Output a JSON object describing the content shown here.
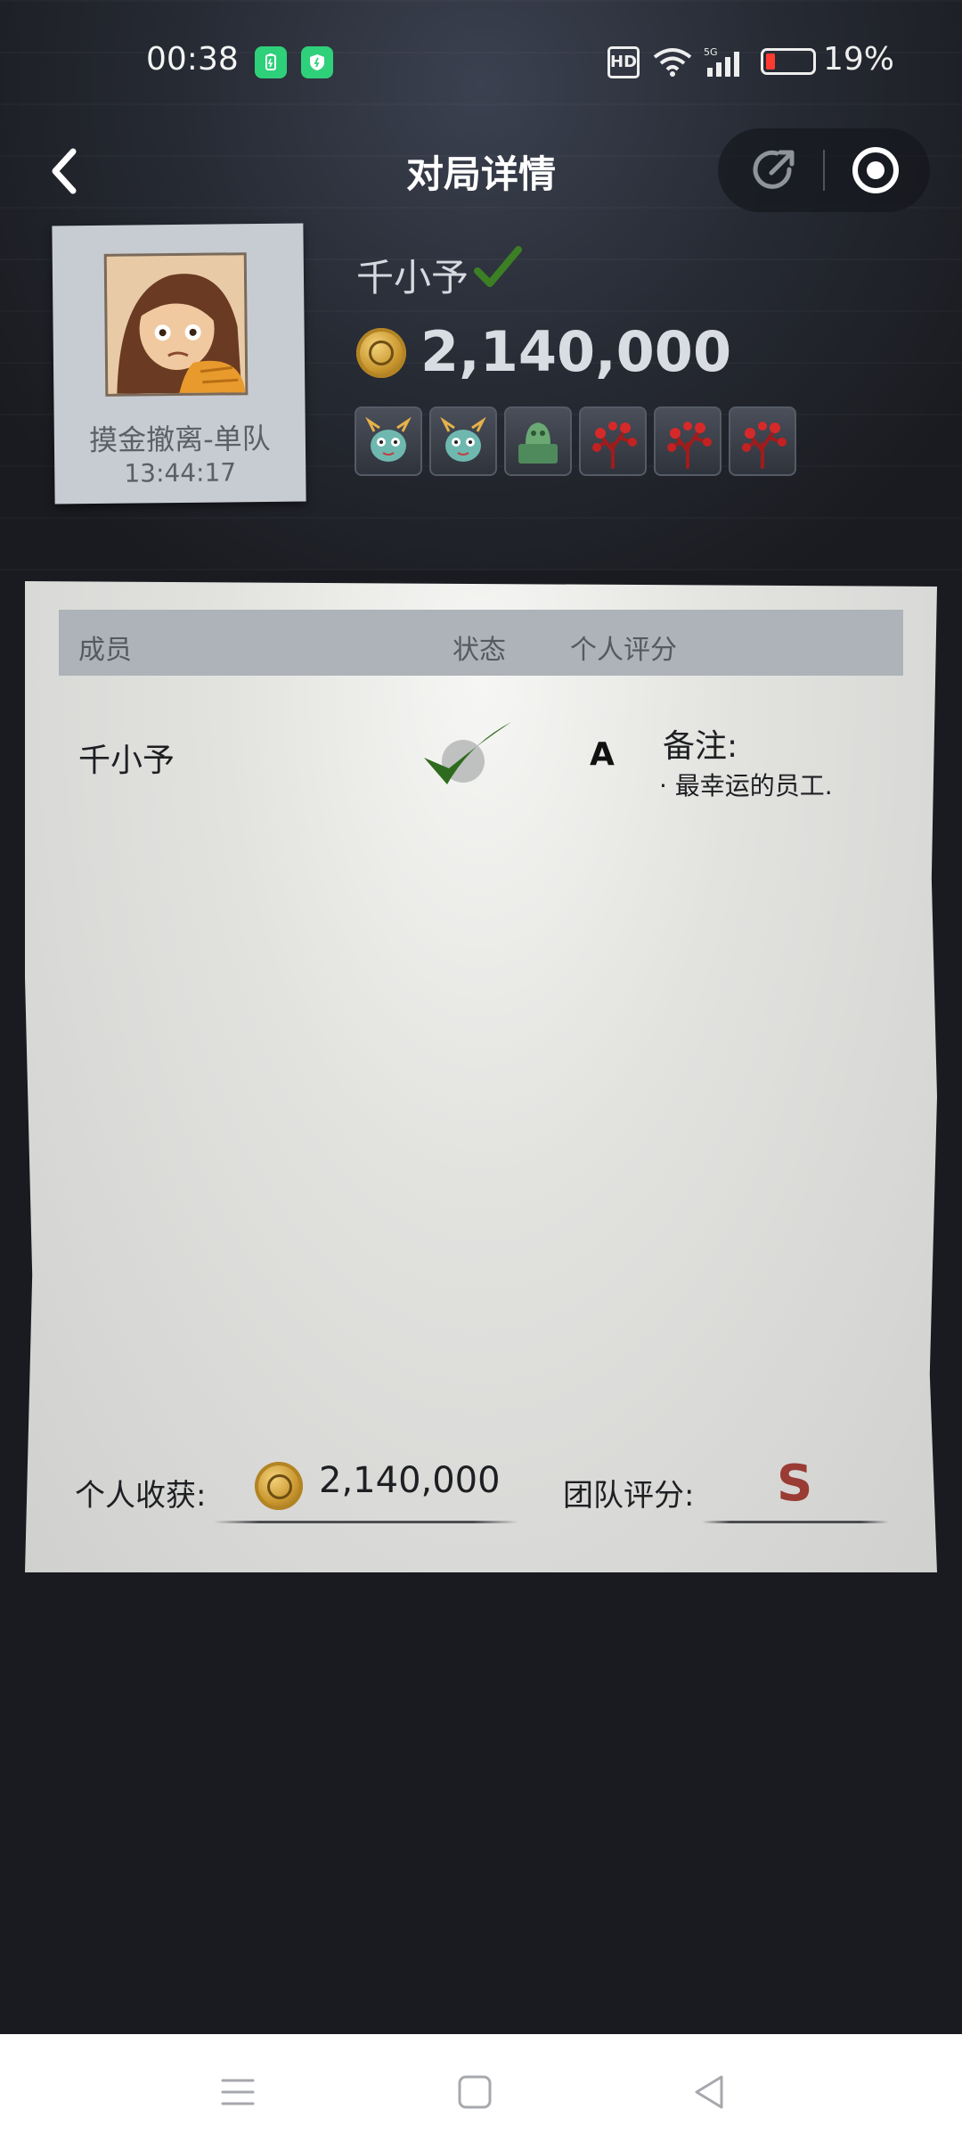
{
  "status_bar": {
    "time": "00:38",
    "network_badge": "HD",
    "network_type": "5G",
    "battery_percent": "19%",
    "battery_level": 0.19,
    "notification_icons": [
      "battery-saver-icon",
      "security-shield-icon"
    ]
  },
  "header": {
    "title": "对局详情",
    "back_icon": "chevron-left-icon",
    "capsule_icons": [
      "share-icon",
      "close-target-icon"
    ]
  },
  "profile_card": {
    "mode": "摸金撤离-单队",
    "time": "13:44:17"
  },
  "player": {
    "name": "千小予",
    "total": "2,140,000",
    "items": [
      "dragon-toy-icon",
      "dragon-toy-icon",
      "jade-seal-icon",
      "red-coral-icon",
      "red-coral-icon",
      "red-coral-icon"
    ]
  },
  "table": {
    "headers": {
      "member": "成员",
      "status": "状态",
      "score": "个人评分"
    },
    "rows": [
      {
        "name": "千小予",
        "status_icon": "checkmark-icon",
        "score": "A",
        "note_label": "备注:",
        "note_text": "· 最幸运的员工."
      }
    ]
  },
  "footer": {
    "income_label": "个人收获:",
    "income_value": "2,140,000",
    "team_label": "团队评分:",
    "team_value": "S"
  },
  "colors": {
    "background": "#1a1b20",
    "paper": "#e2e2df",
    "check_green": "#2f6b1e",
    "team_score": "#9a3b34"
  }
}
